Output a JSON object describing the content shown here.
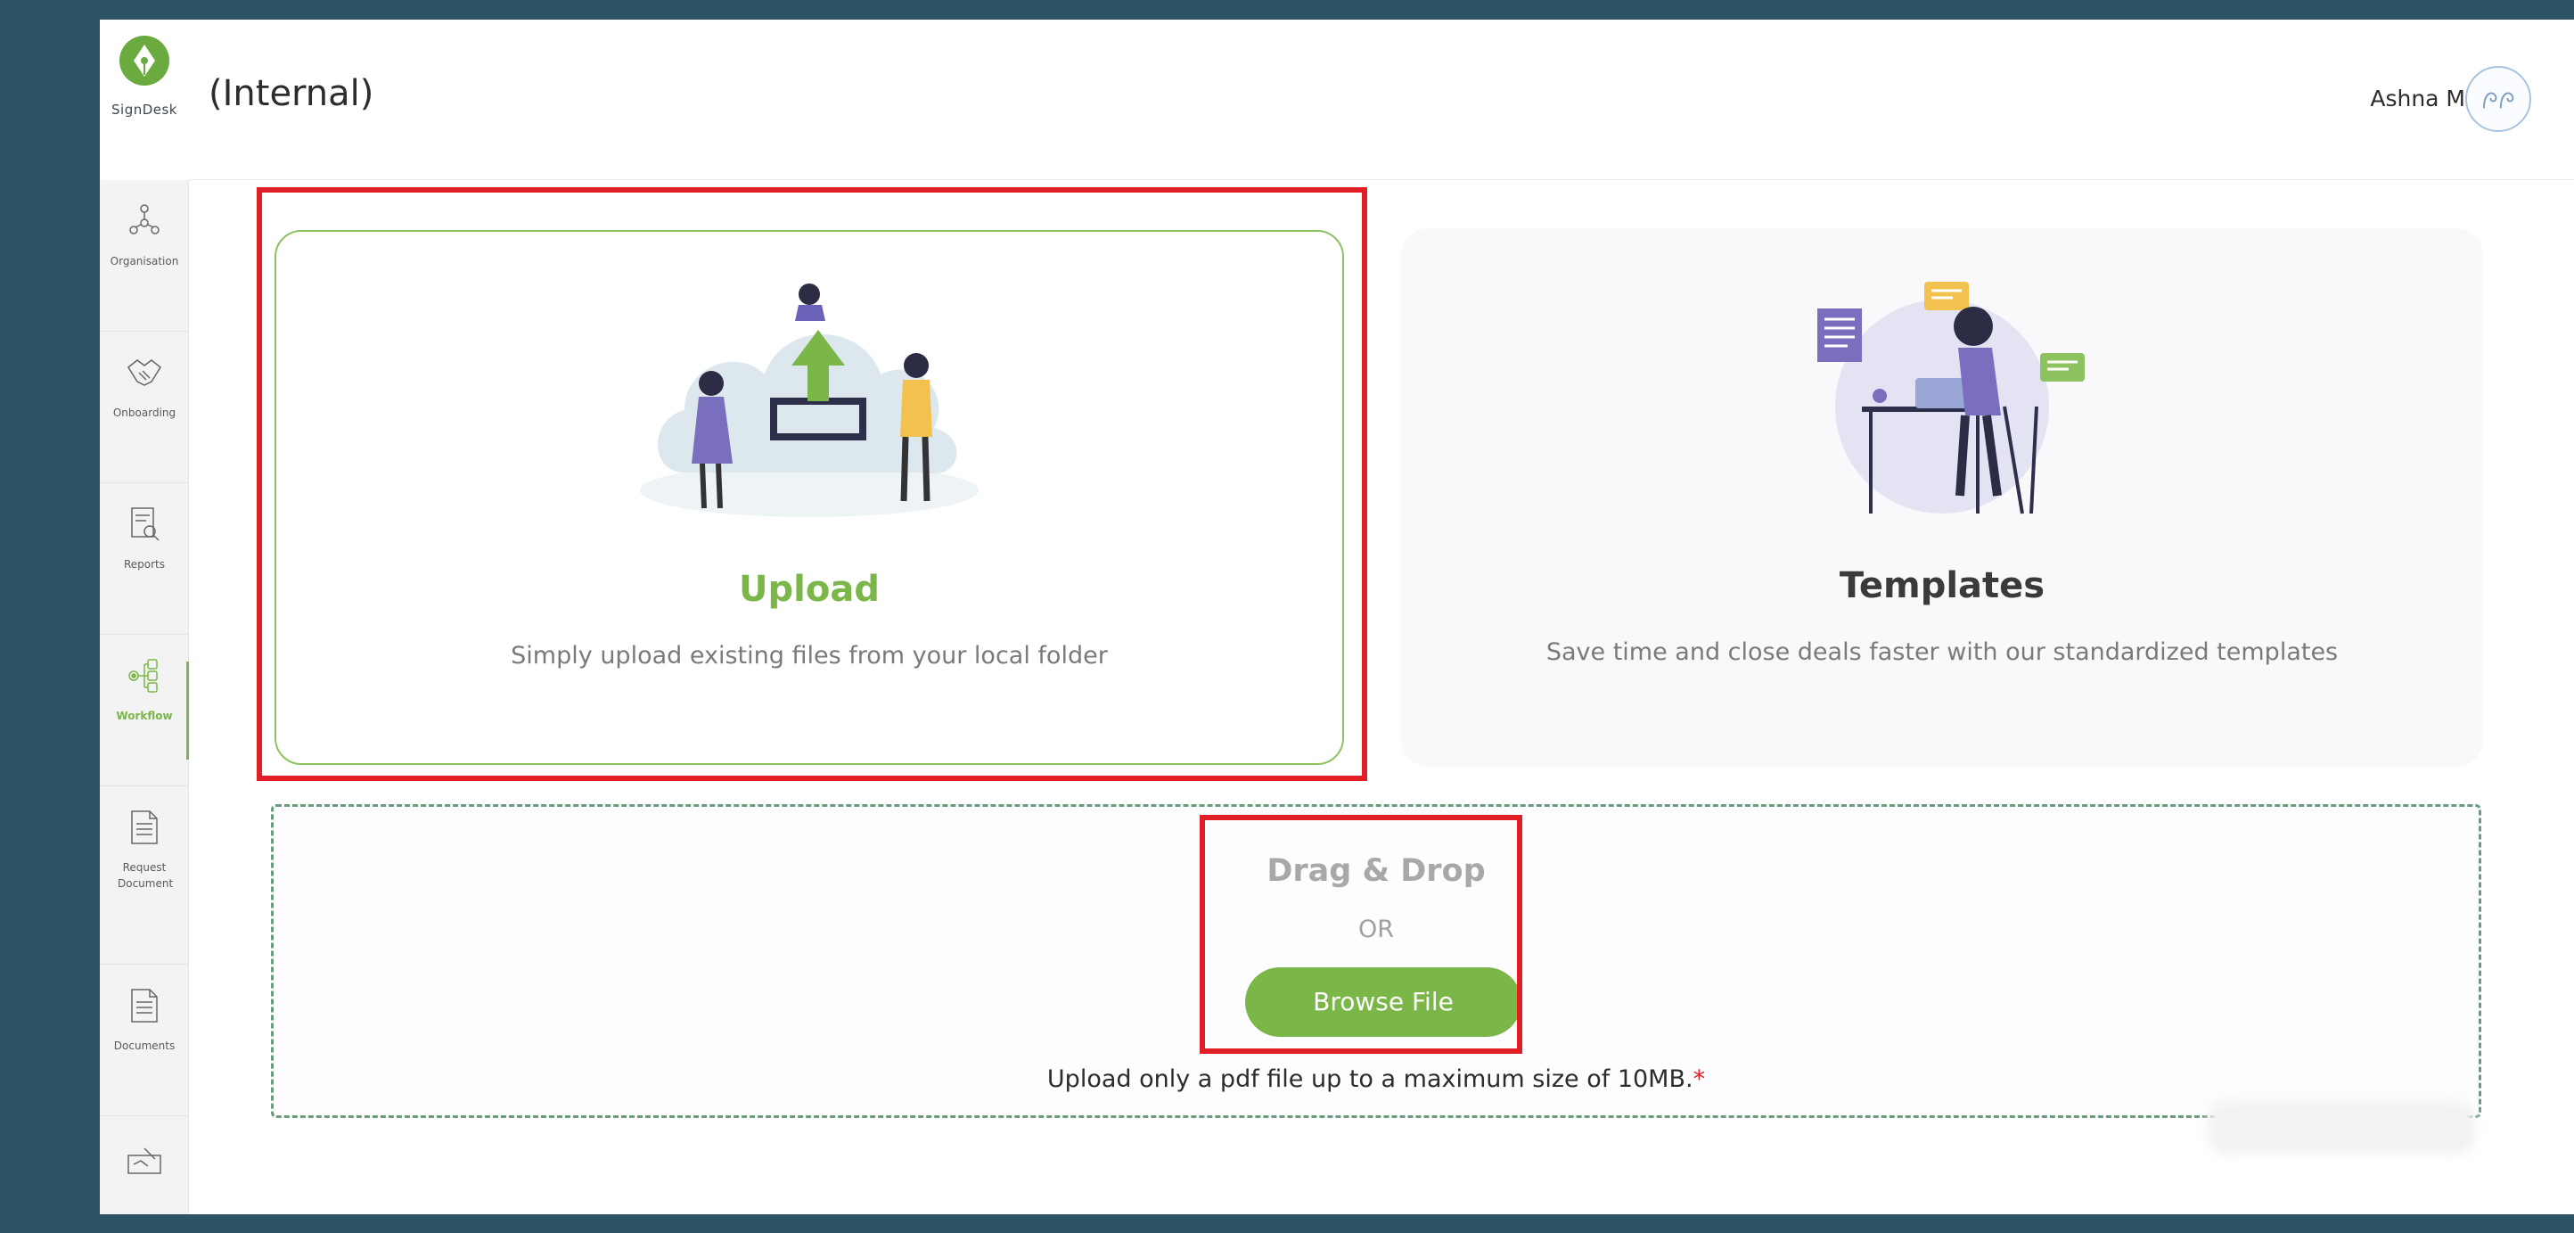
{
  "brand": {
    "name": "SignDesk",
    "accent": "#7ab648",
    "highlight": "#e11d26"
  },
  "header": {
    "title": "(Internal)",
    "user_name": "Ashna M"
  },
  "sidebar": {
    "items": [
      {
        "label": "Organisation",
        "icon": "organisation-icon"
      },
      {
        "label": "Onboarding",
        "icon": "handshake-icon"
      },
      {
        "label": "Reports",
        "icon": "report-search-icon"
      },
      {
        "label": "Workflow",
        "icon": "workflow-icon",
        "active": true
      },
      {
        "label": "Request Document",
        "icon": "document-icon"
      },
      {
        "label": "Documents",
        "icon": "documents-icon"
      },
      {
        "label": "",
        "icon": "sign-hand-icon"
      }
    ]
  },
  "cards": {
    "upload": {
      "title": "Upload",
      "description": "Simply upload existing files from your local folder"
    },
    "templates": {
      "title": "Templates",
      "description": "Save time and close deals faster with our standardized templates"
    }
  },
  "dropzone": {
    "title": "Drag & Drop",
    "or": "OR",
    "browse_label": "Browse File",
    "note": "Upload only a pdf file up to a maximum size of 10MB.",
    "required_mark": "*"
  }
}
